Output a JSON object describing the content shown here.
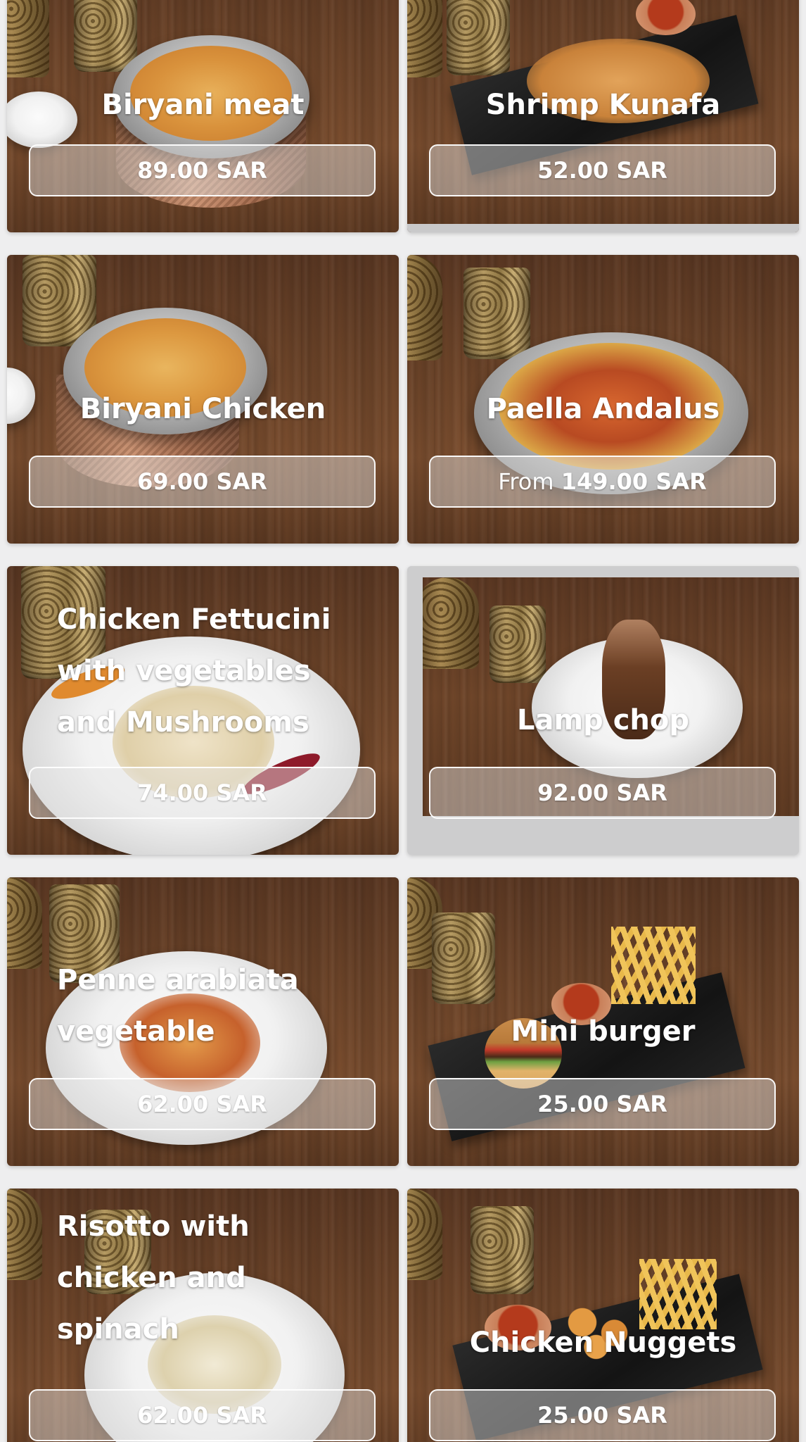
{
  "menu": {
    "items": [
      {
        "name": "Biryani meat",
        "price": "89.00 SAR",
        "prefix": ""
      },
      {
        "name": "Shrimp Kunafa",
        "price": "52.00 SAR",
        "prefix": ""
      },
      {
        "name": "Biryani Chicken",
        "price": "69.00 SAR",
        "prefix": ""
      },
      {
        "name": "Paella Andalus",
        "price": "149.00 SAR",
        "prefix": "From "
      },
      {
        "name": "Chicken Fettucini\nwith vegetables\nand Mushrooms",
        "price": "74.00 SAR",
        "prefix": ""
      },
      {
        "name": "Lamp chop",
        "price": "92.00 SAR",
        "prefix": ""
      },
      {
        "name": "Penne arabiata\nvegetable",
        "price": "62.00 SAR",
        "prefix": ""
      },
      {
        "name": "Mini burger",
        "price": "25.00 SAR",
        "prefix": ""
      },
      {
        "name": "Risotto with\nchicken and\nspinach",
        "price": "62.00 SAR",
        "prefix": ""
      },
      {
        "name": "Chicken Nuggets",
        "price": "25.00 SAR",
        "prefix": ""
      }
    ]
  }
}
